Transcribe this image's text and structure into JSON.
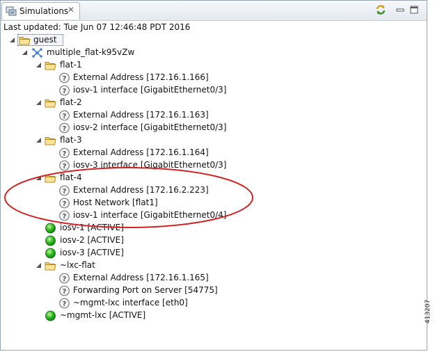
{
  "tab": {
    "title": "Simulations",
    "close": "✕"
  },
  "toolbar": {
    "refresh": "refresh-icon",
    "minimize": "minimize-icon",
    "maximize": "maximize-icon"
  },
  "status": {
    "last_updated": "Last updated: Tue Jun 07 12:46:48 PDT 2016"
  },
  "tree": {
    "root": "guest",
    "topology": "multiple_flat-k95vZw",
    "flat1": {
      "name": "flat-1",
      "ext": "External Address  [172.16.1.166]",
      "iface": "iosv-1 interface  [GigabitEthernet0/3]"
    },
    "flat2": {
      "name": "flat-2",
      "ext": "External Address  [172.16.1.163]",
      "iface": "iosv-2 interface  [GigabitEthernet0/3]"
    },
    "flat3": {
      "name": "flat-3",
      "ext": "External Address  [172.16.1.164]",
      "iface": "iosv-3 interface  [GigabitEthernet0/3]"
    },
    "flat4": {
      "name": "flat-4",
      "ext": "External Address  [172.16.2.223]",
      "host": "Host Network  [flat1]",
      "iface": "iosv-1 interface  [GigabitEthernet0/4]"
    },
    "iosv1": "iosv-1  [ACTIVE]",
    "iosv2": "iosv-2  [ACTIVE]",
    "iosv3": "iosv-3  [ACTIVE]",
    "lxc": {
      "name": "~lxc-flat",
      "ext": "External Address  [172.16.1.165]",
      "port": "Forwarding Port on Server  [54775]",
      "iface": "~mgmt-lxc interface  [eth0]"
    },
    "mgmt": "~mgmt-lxc  [ACTIVE]"
  },
  "figure_id": "413207"
}
